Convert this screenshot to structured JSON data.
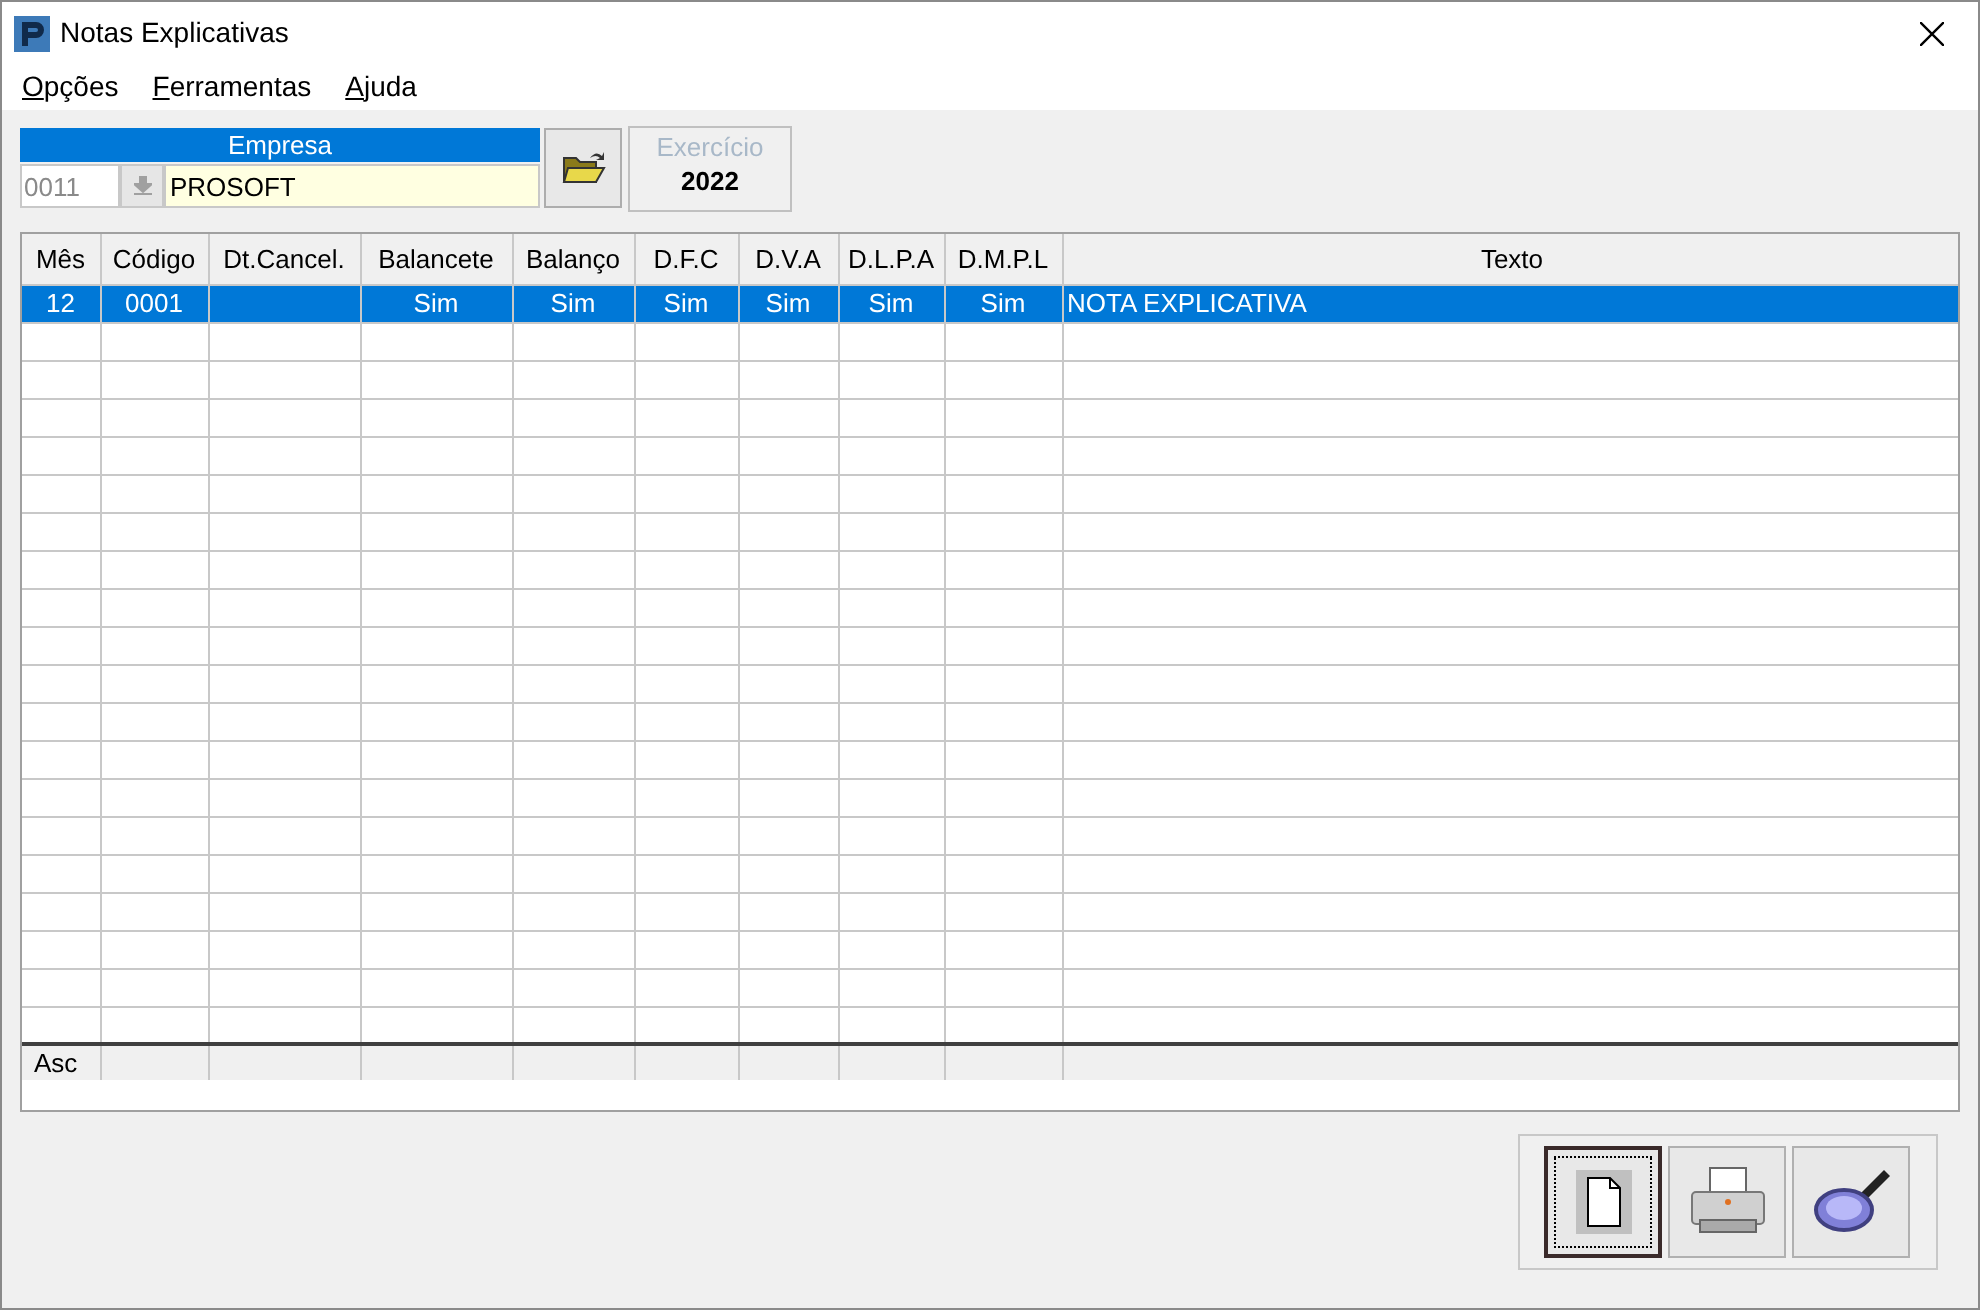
{
  "window": {
    "title": "Notas Explicativas"
  },
  "menu": [
    {
      "label": "Opções"
    },
    {
      "label": "Ferramentas"
    },
    {
      "label": "Ajuda"
    }
  ],
  "empresa": {
    "label": "Empresa",
    "code": "0011",
    "name": "PROSOFT"
  },
  "exercicio": {
    "label": "Exercício",
    "year": "2022"
  },
  "table": {
    "columns": [
      "Mês",
      "Código",
      "Dt.Cancel.",
      "Balancete",
      "Balanço",
      "D.F.C",
      "D.V.A",
      "D.L.P.A",
      "D.M.P.L",
      "Texto"
    ],
    "rows": [
      {
        "selected": true,
        "cells": [
          "12",
          "0001",
          "",
          "Sim",
          "Sim",
          "Sim",
          "Sim",
          "Sim",
          "Sim",
          "NOTA EXPLICATIVA"
        ]
      }
    ],
    "footer": [
      "Asc"
    ]
  },
  "buttons": [
    {
      "kind": "new",
      "focused": true
    },
    {
      "kind": "print",
      "focused": false
    },
    {
      "kind": "search",
      "focused": false
    }
  ]
}
